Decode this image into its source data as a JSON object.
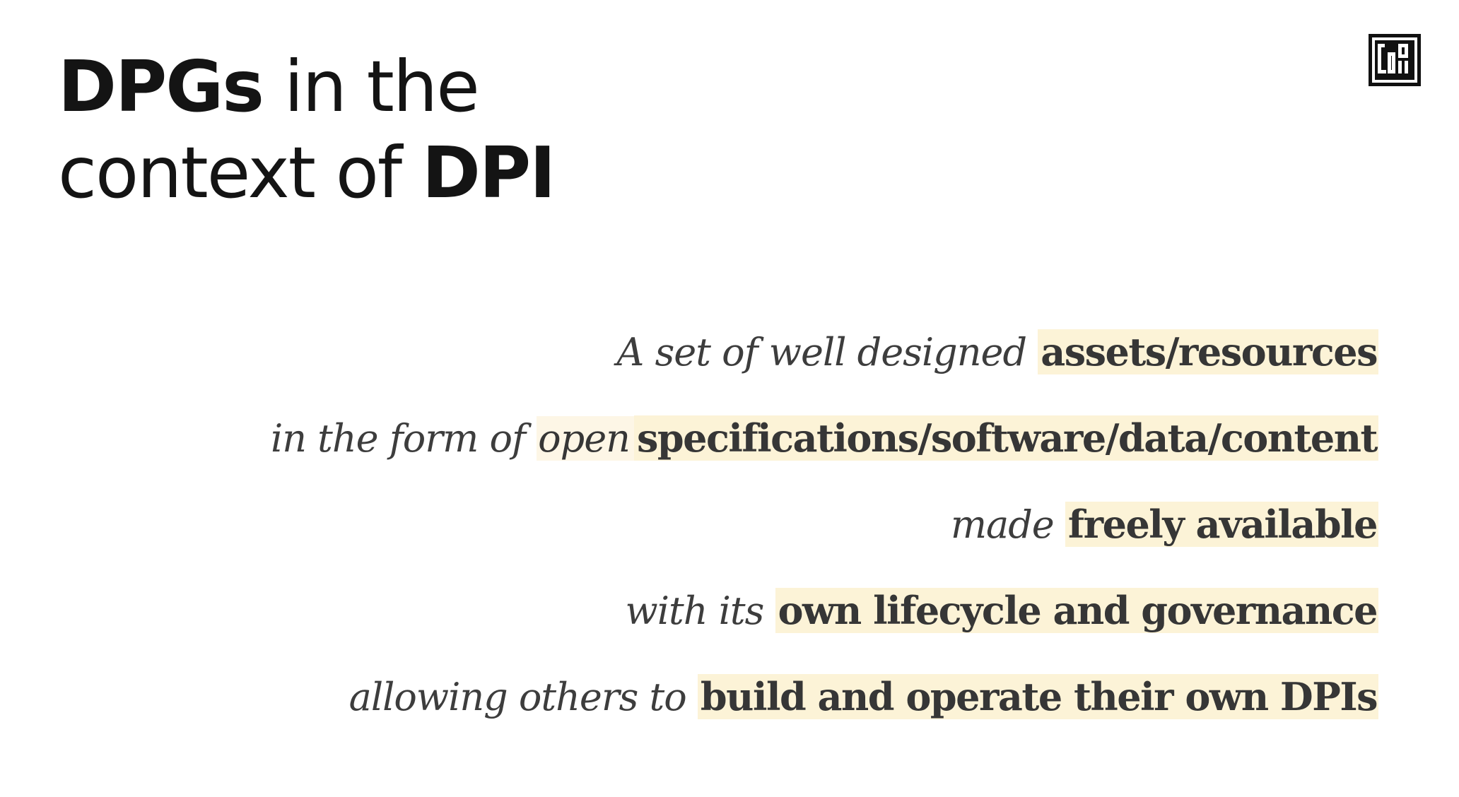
{
  "title": {
    "part1_bold": "DPGs",
    "part2": " in the",
    "part3": "context of ",
    "part4_bold": "DPI"
  },
  "logo": {
    "name": "cdpi-logo",
    "color": "#111111"
  },
  "definition": {
    "lines": [
      {
        "lead": "A set of well designed ",
        "highlight": "assets/resources"
      },
      {
        "lead": "in the form of ",
        "soft": "open",
        "highlight": "specifications/software/data/content"
      },
      {
        "lead": "made ",
        "highlight": "freely available"
      },
      {
        "lead": "with its ",
        "highlight": "own lifecycle and governance"
      },
      {
        "lead": "allowing others to ",
        "highlight": "build and operate their own DPIs"
      }
    ]
  },
  "colors": {
    "background": "#ffffff",
    "title_text": "#141414",
    "body_text": "#363636",
    "highlight": "#fcf3d7",
    "soft_highlight": "#fdf6e6"
  }
}
